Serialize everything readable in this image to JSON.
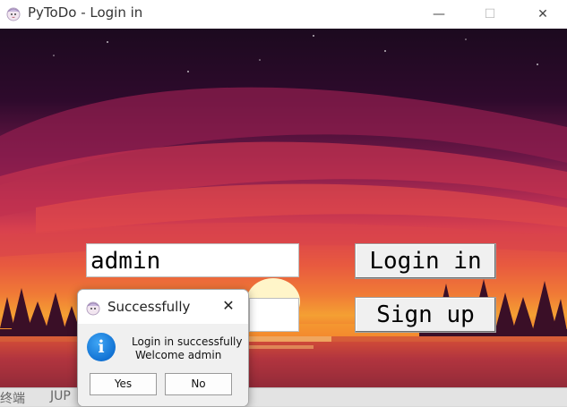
{
  "window": {
    "title": "PyToDo - Login in",
    "controls": {
      "minimize": "—",
      "maximize": "☐",
      "close": "✕"
    }
  },
  "form": {
    "username_value": "admin",
    "login_label": "Login in",
    "signup_label": "Sign up"
  },
  "dialog": {
    "title": "Successfully",
    "close": "✕",
    "icon": "i",
    "message_line1": "Login in successfully",
    "message_line2": "Welcome admin",
    "yes_label": "Yes",
    "no_label": "No"
  },
  "background_app": {
    "text_a": "终端",
    "text_b": "JUP"
  },
  "colors": {
    "sky_top": "#1c0a1f",
    "sun": "#fff5c9",
    "accent_info": "#0f6fd1"
  }
}
